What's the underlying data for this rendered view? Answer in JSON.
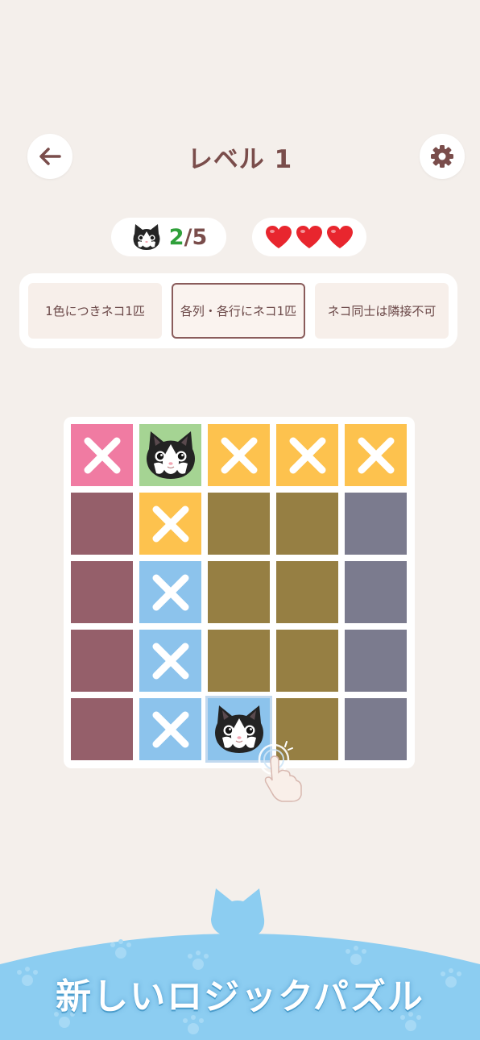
{
  "header": {
    "title": "レベル 1",
    "back_icon": "arrow-left-icon",
    "settings_icon": "gear-icon"
  },
  "status": {
    "cats_found": "2",
    "separator": "/",
    "cats_total": "5",
    "cat_icon": "cat-face-icon",
    "lives": 3,
    "heart_icon": "heart-icon"
  },
  "rules": [
    {
      "label": "1色につきネコ1匹",
      "selected": false
    },
    {
      "label": "各列・各行にネコ1匹",
      "selected": true
    },
    {
      "label": "ネコ同士は隣接不可",
      "selected": false
    }
  ],
  "colors": {
    "pink": "#f07ba2",
    "green": "#a5d493",
    "yellow": "#fdc24e",
    "maroon": "#955f6a",
    "olive": "#967f43",
    "slate": "#7b7b8e",
    "blue": "#8cc3ec",
    "accent_text": "#7a4d4b",
    "count_green": "#2fa03a",
    "heart_red": "#e8262e"
  },
  "board": {
    "size": 5,
    "cells": [
      [
        {
          "color": "pink",
          "mark": "x"
        },
        {
          "color": "green",
          "mark": "cat"
        },
        {
          "color": "yellow",
          "mark": "x"
        },
        {
          "color": "yellow",
          "mark": "x"
        },
        {
          "color": "yellow",
          "mark": "x"
        }
      ],
      [
        {
          "color": "maroon",
          "mark": ""
        },
        {
          "color": "yellow",
          "mark": "x"
        },
        {
          "color": "olive",
          "mark": ""
        },
        {
          "color": "olive",
          "mark": ""
        },
        {
          "color": "slate",
          "mark": ""
        }
      ],
      [
        {
          "color": "maroon",
          "mark": ""
        },
        {
          "color": "blue",
          "mark": "x"
        },
        {
          "color": "olive",
          "mark": ""
        },
        {
          "color": "olive",
          "mark": ""
        },
        {
          "color": "slate",
          "mark": ""
        }
      ],
      [
        {
          "color": "maroon",
          "mark": ""
        },
        {
          "color": "blue",
          "mark": "x"
        },
        {
          "color": "olive",
          "mark": ""
        },
        {
          "color": "olive",
          "mark": ""
        },
        {
          "color": "slate",
          "mark": ""
        }
      ],
      [
        {
          "color": "maroon",
          "mark": ""
        },
        {
          "color": "blue",
          "mark": "x"
        },
        {
          "color": "blue",
          "mark": "cat",
          "selected": true
        },
        {
          "color": "olive",
          "mark": ""
        },
        {
          "color": "slate",
          "mark": ""
        }
      ]
    ]
  },
  "hint": {
    "icon": "tap-hand-icon"
  },
  "banner": {
    "tagline": "新しいロジックパズル"
  }
}
